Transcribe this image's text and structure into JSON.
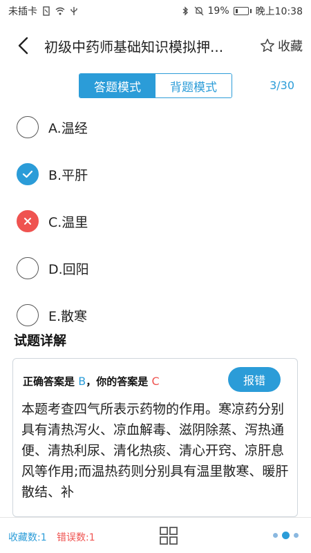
{
  "status_bar": {
    "carrier": "未插卡",
    "battery": "19%",
    "time": "晚上10:38"
  },
  "nav": {
    "title": "初级中药师基础知识模拟押...",
    "favorite_label": "收藏"
  },
  "mode": {
    "answer_mode": "答题模式",
    "recite_mode": "背题模式",
    "progress": "3/30"
  },
  "options": [
    {
      "label": "A.温经",
      "state": "none"
    },
    {
      "label": "B.平肝",
      "state": "correct"
    },
    {
      "label": "C.温里",
      "state": "wrong"
    },
    {
      "label": "D.回阳",
      "state": "none"
    },
    {
      "label": "E.散寒",
      "state": "none"
    }
  ],
  "explanation": {
    "section_title": "试题详解",
    "correct_prefix": "正确答案是",
    "correct_answer": "B",
    "separator": "，",
    "your_prefix": "你的答案是",
    "your_answer": "C",
    "report_label": "报错",
    "text": "本题考查四气所表示药物的作用。寒凉药分别具有清热泻火、凉血解毒、滋阴除蒸、泻热通便、清热利尿、清化热痰、清心开窍、凉肝息风等作用;而温热药则分别具有温里散寒、暖肝散结、补"
  },
  "bottom_bar": {
    "favorite_count": "收藏数:1",
    "error_count": "错误数:1"
  },
  "colors": {
    "accent": "#2b9cd8",
    "error": "#ef5350"
  }
}
